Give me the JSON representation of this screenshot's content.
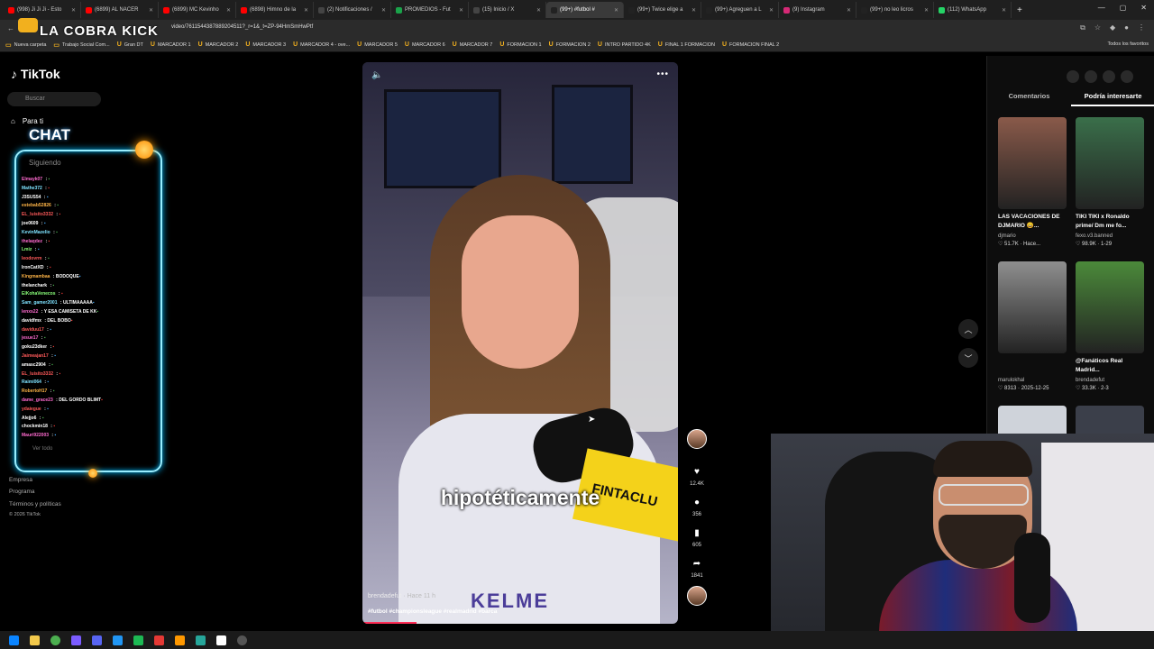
{
  "browser": {
    "tabs": [
      {
        "label": "(998) Ji Ji Ji - Esto",
        "fav": "#ff0000"
      },
      {
        "label": "(6899) AL NACER",
        "fav": "#ff0000"
      },
      {
        "label": "(6899) MC Kevinho",
        "fav": "#ff0000"
      },
      {
        "label": "(6898) Himno de la",
        "fav": "#ff0000"
      },
      {
        "label": "(2) Notificaciones /",
        "fav": "#444444"
      },
      {
        "label": "PROMEDIOS - Fut",
        "fav": "#1aa34a"
      },
      {
        "label": "(15) Inicio / X",
        "fav": "#444444"
      },
      {
        "label": "(99+) #futbol #",
        "fav": "#222222",
        "active": true
      },
      {
        "label": "(99+) Twice elige a",
        "fav": "#222222"
      },
      {
        "label": "(99+) Agreguen a L",
        "fav": "#222222"
      },
      {
        "label": "(9) Instagram",
        "fav": "#d62976"
      },
      {
        "label": "(99+) no leo licros",
        "fav": "#222222"
      },
      {
        "label": "(112) WhatsApp",
        "fav": "#25d366"
      }
    ],
    "url": "video/7611544387889204511?_r=1&_t=ZP-94HmSmHwPtf",
    "bookmarks": [
      "Nueva carpeta",
      "Trabajo Social Com...",
      "Gran DT",
      "MARCADOR 1",
      "MARCADOR 2",
      "MARCADOR 3",
      "MARCADOR 4 - ove...",
      "MARCADOR 5",
      "MARCADOR 6",
      "MARCADOR 7",
      "FORMACION 1",
      "FORMACION 2",
      "INTRO PARTIDO 4K",
      "FINAL 1 FORMACION",
      "FORMACION FINAL 2"
    ],
    "bookmarks_right": "Todos los favoritos"
  },
  "overlay": {
    "channel_logo": "LA COBRA KICK",
    "chat_title": "CHAT",
    "chat_messages": [
      {
        "user": "Elmayk07",
        "text": "",
        "color": "#ff6bd0"
      },
      {
        "user": "Mathe372",
        "text": "",
        "color": "#7ee2ff"
      },
      {
        "user": "J3SUS54",
        "text": "",
        "color": "#ffffff"
      },
      {
        "user": "estebab52826",
        "text": "",
        "color": "#ffb547"
      },
      {
        "user": "EL_luisito3332",
        "text": "",
        "color": "#ff5a5a"
      },
      {
        "user": "joe0609",
        "text": "",
        "color": "#ffffff"
      },
      {
        "user": "KevinMazelio",
        "text": "",
        "color": "#7ee2ff"
      },
      {
        "user": "thelaqdez",
        "text": "",
        "color": "#ff6bd0"
      },
      {
        "user": "Lmiz",
        "text": "",
        "color": "#8aff7a"
      },
      {
        "user": "leodovrm",
        "text": "",
        "color": "#ff5a5a"
      },
      {
        "user": "IronCatXD",
        "text": "",
        "color": "#ffffff"
      },
      {
        "user": "Kingmambaa",
        "text": "BODOQUE",
        "color": "#ffb547"
      },
      {
        "user": "thelanchark",
        "text": "",
        "color": "#ffffff"
      },
      {
        "user": "ElKohaVenecos",
        "text": "",
        "color": "#8aff7a"
      },
      {
        "user": "Sam_gamer2001",
        "text": "ULTIMAAAAA",
        "color": "#7ee2ff"
      },
      {
        "user": "lenxs22",
        "text": "Y ESA CAMISETA DE KK",
        "color": "#ff6bd0"
      },
      {
        "user": "davidfmx",
        "text": "DEL BOBO",
        "color": "#ffffff"
      },
      {
        "user": "daviduu17",
        "text": "",
        "color": "#ff5a5a"
      },
      {
        "user": "jesue17",
        "text": "",
        "color": "#ff6bd0"
      },
      {
        "user": "goku23dker",
        "text": "",
        "color": "#ffffff"
      },
      {
        "user": "Jaimeajan17",
        "text": "",
        "color": "#ff5a5a"
      },
      {
        "user": "amasc2904",
        "text": "",
        "color": "#ffffff"
      },
      {
        "user": "EL_luisito3332",
        "text": "",
        "color": "#ff5a5a"
      },
      {
        "user": "Raimi064",
        "text": "",
        "color": "#7ee2ff"
      },
      {
        "user": "RobertoH17",
        "text": "",
        "color": "#ffb547"
      },
      {
        "user": "dame_grace23",
        "text": "DEL GORDO BLIMT",
        "color": "#ff6bd0"
      },
      {
        "user": "ydaiegue",
        "text": "",
        "color": "#ff5a5a"
      },
      {
        "user": "Alejjo6",
        "text": "",
        "color": "#ffffff"
      },
      {
        "user": "chockmin18",
        "text": "",
        "color": "#ffffff"
      },
      {
        "user": "Mauri922003",
        "text": "",
        "color": "#ff6bd0"
      }
    ]
  },
  "tiktok": {
    "brand": "TikTok",
    "search_placeholder": "Buscar",
    "nav_for_you": "Para ti",
    "nav_following": "Siguiendo",
    "ver_todo": "Ver todo",
    "footer": [
      "Empresa",
      "Programa",
      "Términos y políticas",
      "© 2026 TikTok"
    ]
  },
  "video": {
    "caption": "hipotéticamente",
    "author": "brendadefut",
    "time_ago": "· Hace 11 h",
    "hashtags": "#futbol #championsleague #realmadrid #barca",
    "brand_on_shirt": "KELME",
    "mic_sign": "FINTACLU",
    "likes": "12.4K",
    "comments": "356",
    "saves": "605",
    "shares": "1841"
  },
  "right_panel": {
    "tab_comments": "Comentarios",
    "tab_interest": "Podría interesarte",
    "cards": [
      {
        "title": "LAS VACACIONES DE DJMARIO 😄...",
        "author": "djmario",
        "meta": "♡ 51.7K · Hace...",
        "thumb": "#8a5a4a"
      },
      {
        "title": "TIKI TIKI x Ronaldo prime/ Dm me fo...",
        "author": "fexo.v3.banned",
        "meta": "♡ 98.9K · 1-29",
        "thumb": "#3a6f4a"
      },
      {
        "title": "",
        "author": "marulokhal",
        "meta": "♡ 8313 · 2025-12-25",
        "thumb": "#8f8f8f"
      },
      {
        "title": "@Fanáticos Real Madrid...",
        "author": "brendadefut",
        "meta": "♡ 33.3K · 2-3",
        "thumb": "#4b8a3a"
      }
    ]
  }
}
